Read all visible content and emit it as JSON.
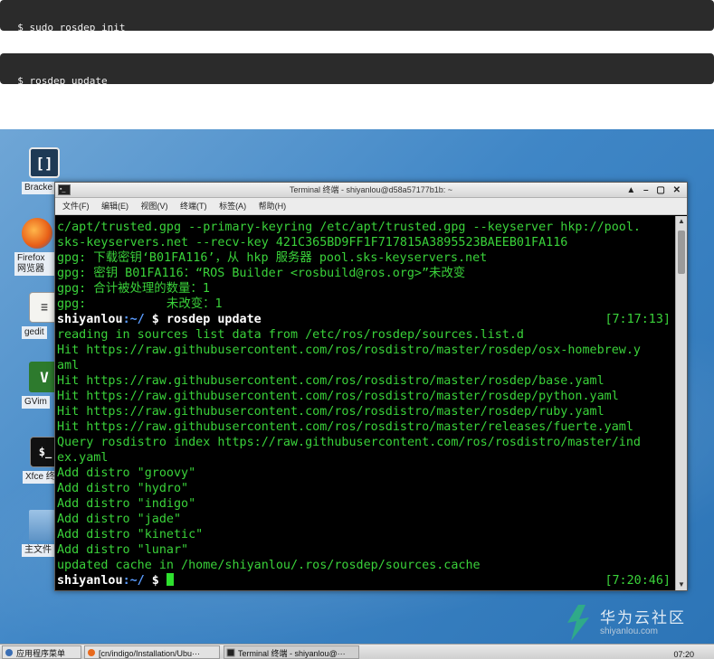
{
  "commands": [
    {
      "text": "$ sudo rosdep init"
    },
    {
      "text": "$ rosdep update"
    }
  ],
  "desktop": {
    "icons": [
      {
        "label": "Bracke",
        "glyph": "[]",
        "icon": "brackets-icon"
      },
      {
        "label": "Firefox 网览器",
        "glyph": "",
        "icon": "firefox-icon"
      },
      {
        "label": "gedit",
        "glyph": "≡",
        "icon": "gedit-icon"
      },
      {
        "label": "GVim",
        "glyph": "V",
        "icon": "gvim-icon"
      },
      {
        "label": "Xfce 终",
        "glyph": "$_",
        "icon": "xfce-terminal-icon"
      },
      {
        "label": "主文件",
        "glyph": "",
        "icon": "home-folder-icon"
      }
    ]
  },
  "terminal": {
    "title": "Terminal 终端 - shiyanlou@d58a57177b1b: ~",
    "app_icon": "▪_",
    "window_controls": "▲ – ▢ ✕",
    "menu": [
      "文件(F)",
      "编辑(E)",
      "视图(V)",
      "终端(T)",
      "标签(A)",
      "帮助(H)"
    ],
    "lines": [
      {
        "text": "c/apt/trusted.gpg --primary-keyring /etc/apt/trusted.gpg --keyserver hkp://pool."
      },
      {
        "text": "sks-keyservers.net --recv-key 421C365BD9FF1F717815A3895523BAEEB01FA116"
      },
      {
        "text": "gpg: 下载密钥‘B01FA116’，从 hkp 服务器 pool.sks-keyservers.net"
      },
      {
        "text": "gpg: 密钥 B01FA116：“ROS Builder <rosbuild@ros.org>”未改变"
      },
      {
        "text": "gpg: 合计被处理的数量：1"
      },
      {
        "text": "gpg:           未改变：1"
      },
      {
        "prompt_user": "shiyanlou",
        "prompt_dir": ":~/",
        "text": " $ rosdep update",
        "time": "[7:17:13]"
      },
      {
        "text": "reading in sources list data from /etc/ros/rosdep/sources.list.d"
      },
      {
        "text": "Hit https://raw.githubusercontent.com/ros/rosdistro/master/rosdep/osx-homebrew.y"
      },
      {
        "text": "aml"
      },
      {
        "text": "Hit https://raw.githubusercontent.com/ros/rosdistro/master/rosdep/base.yaml"
      },
      {
        "text": "Hit https://raw.githubusercontent.com/ros/rosdistro/master/rosdep/python.yaml"
      },
      {
        "text": "Hit https://raw.githubusercontent.com/ros/rosdistro/master/rosdep/ruby.yaml"
      },
      {
        "text": "Hit https://raw.githubusercontent.com/ros/rosdistro/master/releases/fuerte.yaml"
      },
      {
        "text": "Query rosdistro index https://raw.githubusercontent.com/ros/rosdistro/master/ind"
      },
      {
        "text": "ex.yaml"
      },
      {
        "text": "Add distro \"groovy\""
      },
      {
        "text": "Add distro \"hydro\""
      },
      {
        "text": "Add distro \"indigo\""
      },
      {
        "text": "Add distro \"jade\""
      },
      {
        "text": "Add distro \"kinetic\""
      },
      {
        "text": "Add distro \"lunar\""
      },
      {
        "text": "updated cache in /home/shiyanlou/.ros/rosdep/sources.cache"
      },
      {
        "prompt_user": "shiyanlou",
        "prompt_dir": ":~/",
        "text": " $ ",
        "time": "[7:20:46]",
        "cursor": true
      }
    ]
  },
  "taskbar": {
    "start_label": "应用程序菜单",
    "tasks": [
      {
        "label": "[cn/indigo/Installation/Ubu···"
      },
      {
        "label": "Terminal 终端 - shiyanlou@···"
      }
    ],
    "clock": "07:20"
  },
  "watermark": {
    "text": "华为云社区",
    "url": "shiyanlou.com"
  }
}
